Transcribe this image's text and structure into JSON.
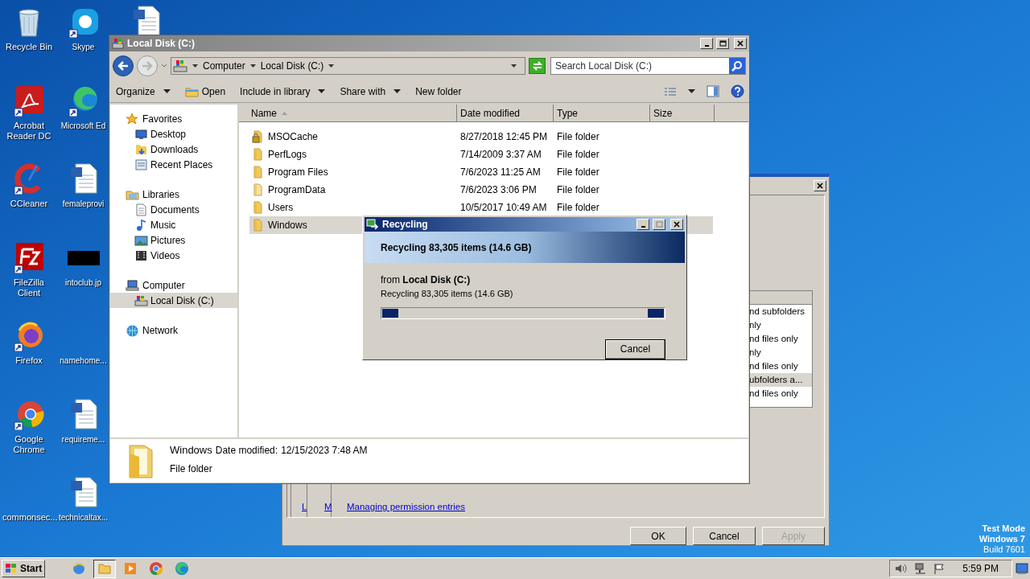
{
  "desktop_icons": [
    {
      "label": "Recycle Bin"
    },
    {
      "label": "Skype"
    },
    {
      "label": "Acrobat Reader DC"
    },
    {
      "label": "Microsoft Ed"
    },
    {
      "label": "CCleaner"
    },
    {
      "label": "femaleprovi"
    },
    {
      "label": "FileZilla Client"
    },
    {
      "label": "intoclub.jp"
    },
    {
      "label": "Firefox"
    },
    {
      "label": "namehome..."
    },
    {
      "label": "Google Chrome"
    },
    {
      "label": "requireme..."
    },
    {
      "label": "commonsec..."
    },
    {
      "label": "technicaltax..."
    }
  ],
  "explorer": {
    "title": "Local Disk (C:)",
    "breadcrumb": [
      "Computer",
      "Local Disk (C:)"
    ],
    "search": {
      "placeholder": "Search Local Disk (C:)"
    },
    "toolbar": [
      {
        "label": "Organize",
        "dropdown": true
      },
      {
        "label": "Open",
        "dropdown": false
      },
      {
        "label": "Include in library",
        "dropdown": true
      },
      {
        "label": "Share with",
        "dropdown": true
      },
      {
        "label": "New folder",
        "dropdown": false
      }
    ],
    "nav": [
      {
        "label": "Favorites",
        "selected": false,
        "children": [
          {
            "label": "Desktop",
            "selected": false
          },
          {
            "label": "Downloads",
            "selected": false
          },
          {
            "label": "Recent Places",
            "selected": false
          }
        ]
      },
      {
        "label": "Libraries",
        "selected": false,
        "children": [
          {
            "label": "Documents",
            "selected": false
          },
          {
            "label": "Music",
            "selected": false
          },
          {
            "label": "Pictures",
            "selected": false
          },
          {
            "label": "Videos",
            "selected": false
          }
        ]
      },
      {
        "label": "Computer",
        "selected": false,
        "children": [
          {
            "label": "Local Disk (C:)",
            "selected": true
          }
        ]
      },
      {
        "label": "Network",
        "selected": false
      }
    ],
    "columns": [
      "Name",
      "Date modified",
      "Type",
      "Size"
    ],
    "rows": [
      {
        "name": "MSOCache",
        "date": "8/27/2018 12:45 PM",
        "type": "File folder",
        "kind": "locked",
        "selected": false
      },
      {
        "name": "PerfLogs",
        "date": "7/14/2009 3:37 AM",
        "type": "File folder",
        "kind": "folder",
        "selected": false
      },
      {
        "name": "Program Files",
        "date": "7/6/2023 11:25 AM",
        "type": "File folder",
        "kind": "folder",
        "selected": false
      },
      {
        "name": "ProgramData",
        "date": "7/6/2023 3:06 PM",
        "type": "File folder",
        "kind": "hidden",
        "selected": false
      },
      {
        "name": "Users",
        "date": "10/5/2017 10:49 AM",
        "type": "File folder",
        "kind": "folder",
        "selected": false
      },
      {
        "name": "Windows",
        "date": "",
        "type": "",
        "kind": "folder",
        "selected": true
      }
    ],
    "details": {
      "name": "Windows",
      "date_label": "Date modified:",
      "date": "12/15/2023 7:48 AM",
      "type": "File folder"
    }
  },
  "recycling": {
    "title": "Recycling",
    "heading": "Recycling 83,305 items (14.6 GB)",
    "from": "from **Local Disk (C:)**",
    "status": "Recycling 83,305 items (14.6 GB)",
    "indeterminate": true,
    "button": "Cancel"
  },
  "permissions": {
    "list_items": [
      {
        "text": "nd subfolders",
        "selected": false
      },
      {
        "text": "nly",
        "selected": false
      },
      {
        "text": "nd files only",
        "selected": false
      },
      {
        "text": "nly",
        "selected": false
      },
      {
        "text": "nd files only",
        "selected": false
      },
      {
        "text": "ubfolders a...",
        "selected": true
      },
      {
        "text": "nd files only",
        "selected": false
      }
    ],
    "links": [
      "L",
      "M",
      "Managing permission entries"
    ],
    "buttons": [
      {
        "label": "OK",
        "disabled": false
      },
      {
        "label": "Cancel",
        "disabled": false
      },
      {
        "label": "Apply",
        "disabled": true
      }
    ]
  },
  "taskbar": {
    "start": "Start",
    "apps": [
      {
        "selected": false
      },
      {
        "selected": true
      },
      {
        "selected": false
      },
      {
        "selected": false
      },
      {
        "selected": false
      }
    ],
    "clock": "5:59 PM"
  },
  "os_notice": [
    "Test Mode",
    "Windows 7",
    "Build 7601"
  ]
}
